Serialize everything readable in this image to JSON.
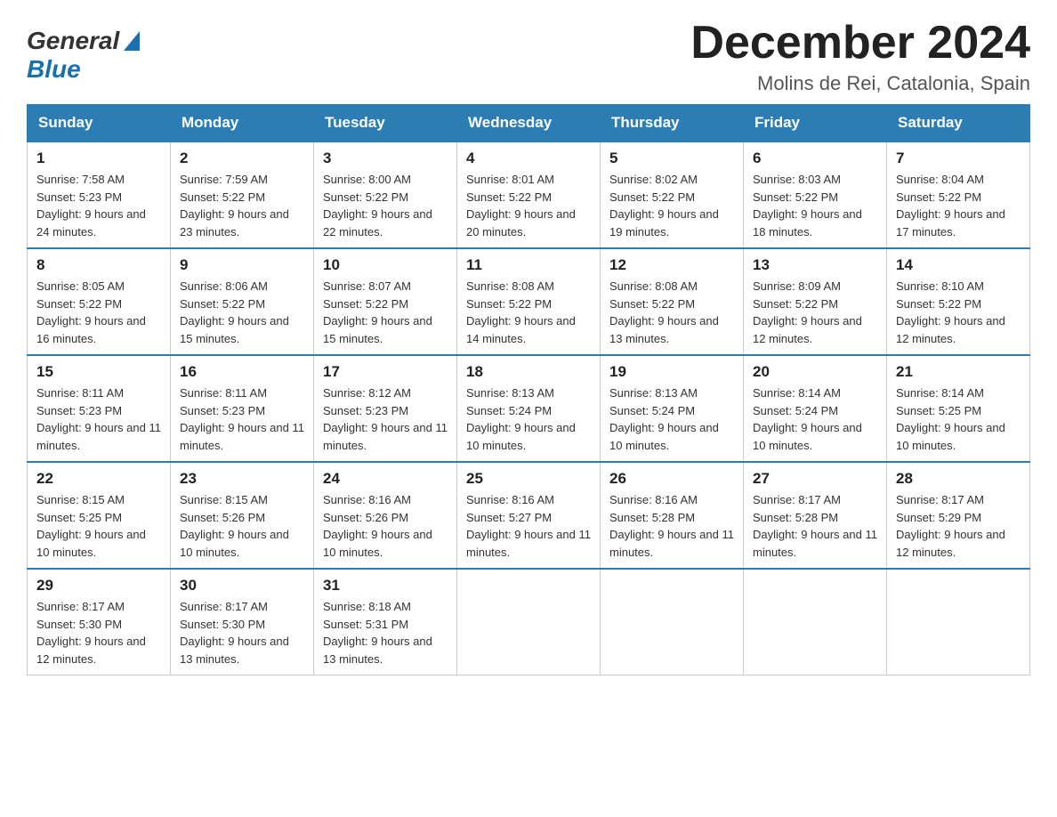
{
  "logo": {
    "general": "General",
    "blue": "Blue"
  },
  "header": {
    "title": "December 2024",
    "location": "Molins de Rei, Catalonia, Spain"
  },
  "weekdays": [
    "Sunday",
    "Monday",
    "Tuesday",
    "Wednesday",
    "Thursday",
    "Friday",
    "Saturday"
  ],
  "weeks": [
    [
      {
        "day": "1",
        "sunrise": "Sunrise: 7:58 AM",
        "sunset": "Sunset: 5:23 PM",
        "daylight": "Daylight: 9 hours and 24 minutes."
      },
      {
        "day": "2",
        "sunrise": "Sunrise: 7:59 AM",
        "sunset": "Sunset: 5:22 PM",
        "daylight": "Daylight: 9 hours and 23 minutes."
      },
      {
        "day": "3",
        "sunrise": "Sunrise: 8:00 AM",
        "sunset": "Sunset: 5:22 PM",
        "daylight": "Daylight: 9 hours and 22 minutes."
      },
      {
        "day": "4",
        "sunrise": "Sunrise: 8:01 AM",
        "sunset": "Sunset: 5:22 PM",
        "daylight": "Daylight: 9 hours and 20 minutes."
      },
      {
        "day": "5",
        "sunrise": "Sunrise: 8:02 AM",
        "sunset": "Sunset: 5:22 PM",
        "daylight": "Daylight: 9 hours and 19 minutes."
      },
      {
        "day": "6",
        "sunrise": "Sunrise: 8:03 AM",
        "sunset": "Sunset: 5:22 PM",
        "daylight": "Daylight: 9 hours and 18 minutes."
      },
      {
        "day": "7",
        "sunrise": "Sunrise: 8:04 AM",
        "sunset": "Sunset: 5:22 PM",
        "daylight": "Daylight: 9 hours and 17 minutes."
      }
    ],
    [
      {
        "day": "8",
        "sunrise": "Sunrise: 8:05 AM",
        "sunset": "Sunset: 5:22 PM",
        "daylight": "Daylight: 9 hours and 16 minutes."
      },
      {
        "day": "9",
        "sunrise": "Sunrise: 8:06 AM",
        "sunset": "Sunset: 5:22 PM",
        "daylight": "Daylight: 9 hours and 15 minutes."
      },
      {
        "day": "10",
        "sunrise": "Sunrise: 8:07 AM",
        "sunset": "Sunset: 5:22 PM",
        "daylight": "Daylight: 9 hours and 15 minutes."
      },
      {
        "day": "11",
        "sunrise": "Sunrise: 8:08 AM",
        "sunset": "Sunset: 5:22 PM",
        "daylight": "Daylight: 9 hours and 14 minutes."
      },
      {
        "day": "12",
        "sunrise": "Sunrise: 8:08 AM",
        "sunset": "Sunset: 5:22 PM",
        "daylight": "Daylight: 9 hours and 13 minutes."
      },
      {
        "day": "13",
        "sunrise": "Sunrise: 8:09 AM",
        "sunset": "Sunset: 5:22 PM",
        "daylight": "Daylight: 9 hours and 12 minutes."
      },
      {
        "day": "14",
        "sunrise": "Sunrise: 8:10 AM",
        "sunset": "Sunset: 5:22 PM",
        "daylight": "Daylight: 9 hours and 12 minutes."
      }
    ],
    [
      {
        "day": "15",
        "sunrise": "Sunrise: 8:11 AM",
        "sunset": "Sunset: 5:23 PM",
        "daylight": "Daylight: 9 hours and 11 minutes."
      },
      {
        "day": "16",
        "sunrise": "Sunrise: 8:11 AM",
        "sunset": "Sunset: 5:23 PM",
        "daylight": "Daylight: 9 hours and 11 minutes."
      },
      {
        "day": "17",
        "sunrise": "Sunrise: 8:12 AM",
        "sunset": "Sunset: 5:23 PM",
        "daylight": "Daylight: 9 hours and 11 minutes."
      },
      {
        "day": "18",
        "sunrise": "Sunrise: 8:13 AM",
        "sunset": "Sunset: 5:24 PM",
        "daylight": "Daylight: 9 hours and 10 minutes."
      },
      {
        "day": "19",
        "sunrise": "Sunrise: 8:13 AM",
        "sunset": "Sunset: 5:24 PM",
        "daylight": "Daylight: 9 hours and 10 minutes."
      },
      {
        "day": "20",
        "sunrise": "Sunrise: 8:14 AM",
        "sunset": "Sunset: 5:24 PM",
        "daylight": "Daylight: 9 hours and 10 minutes."
      },
      {
        "day": "21",
        "sunrise": "Sunrise: 8:14 AM",
        "sunset": "Sunset: 5:25 PM",
        "daylight": "Daylight: 9 hours and 10 minutes."
      }
    ],
    [
      {
        "day": "22",
        "sunrise": "Sunrise: 8:15 AM",
        "sunset": "Sunset: 5:25 PM",
        "daylight": "Daylight: 9 hours and 10 minutes."
      },
      {
        "day": "23",
        "sunrise": "Sunrise: 8:15 AM",
        "sunset": "Sunset: 5:26 PM",
        "daylight": "Daylight: 9 hours and 10 minutes."
      },
      {
        "day": "24",
        "sunrise": "Sunrise: 8:16 AM",
        "sunset": "Sunset: 5:26 PM",
        "daylight": "Daylight: 9 hours and 10 minutes."
      },
      {
        "day": "25",
        "sunrise": "Sunrise: 8:16 AM",
        "sunset": "Sunset: 5:27 PM",
        "daylight": "Daylight: 9 hours and 11 minutes."
      },
      {
        "day": "26",
        "sunrise": "Sunrise: 8:16 AM",
        "sunset": "Sunset: 5:28 PM",
        "daylight": "Daylight: 9 hours and 11 minutes."
      },
      {
        "day": "27",
        "sunrise": "Sunrise: 8:17 AM",
        "sunset": "Sunset: 5:28 PM",
        "daylight": "Daylight: 9 hours and 11 minutes."
      },
      {
        "day": "28",
        "sunrise": "Sunrise: 8:17 AM",
        "sunset": "Sunset: 5:29 PM",
        "daylight": "Daylight: 9 hours and 12 minutes."
      }
    ],
    [
      {
        "day": "29",
        "sunrise": "Sunrise: 8:17 AM",
        "sunset": "Sunset: 5:30 PM",
        "daylight": "Daylight: 9 hours and 12 minutes."
      },
      {
        "day": "30",
        "sunrise": "Sunrise: 8:17 AM",
        "sunset": "Sunset: 5:30 PM",
        "daylight": "Daylight: 9 hours and 13 minutes."
      },
      {
        "day": "31",
        "sunrise": "Sunrise: 8:18 AM",
        "sunset": "Sunset: 5:31 PM",
        "daylight": "Daylight: 9 hours and 13 minutes."
      },
      null,
      null,
      null,
      null
    ]
  ]
}
